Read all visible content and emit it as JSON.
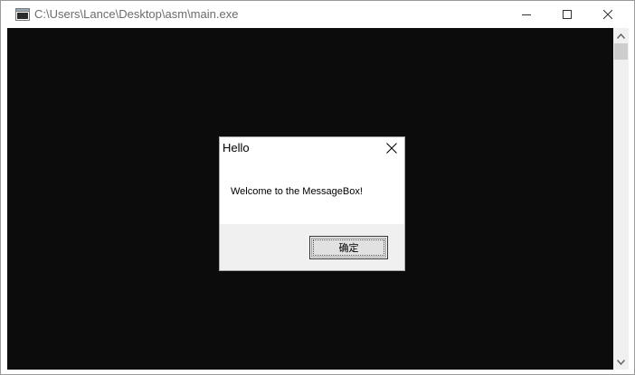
{
  "window": {
    "title": "C:\\Users\\Lance\\Desktop\\asm\\main.exe",
    "icon": "console-app-icon",
    "caption_buttons": [
      "minimize-icon",
      "maximize-icon",
      "close-icon"
    ]
  },
  "console": {
    "background": "#0c0c0c"
  },
  "message_box": {
    "title": "Hello",
    "text": "Welcome to the MessageBox!",
    "ok_label": "确定"
  }
}
